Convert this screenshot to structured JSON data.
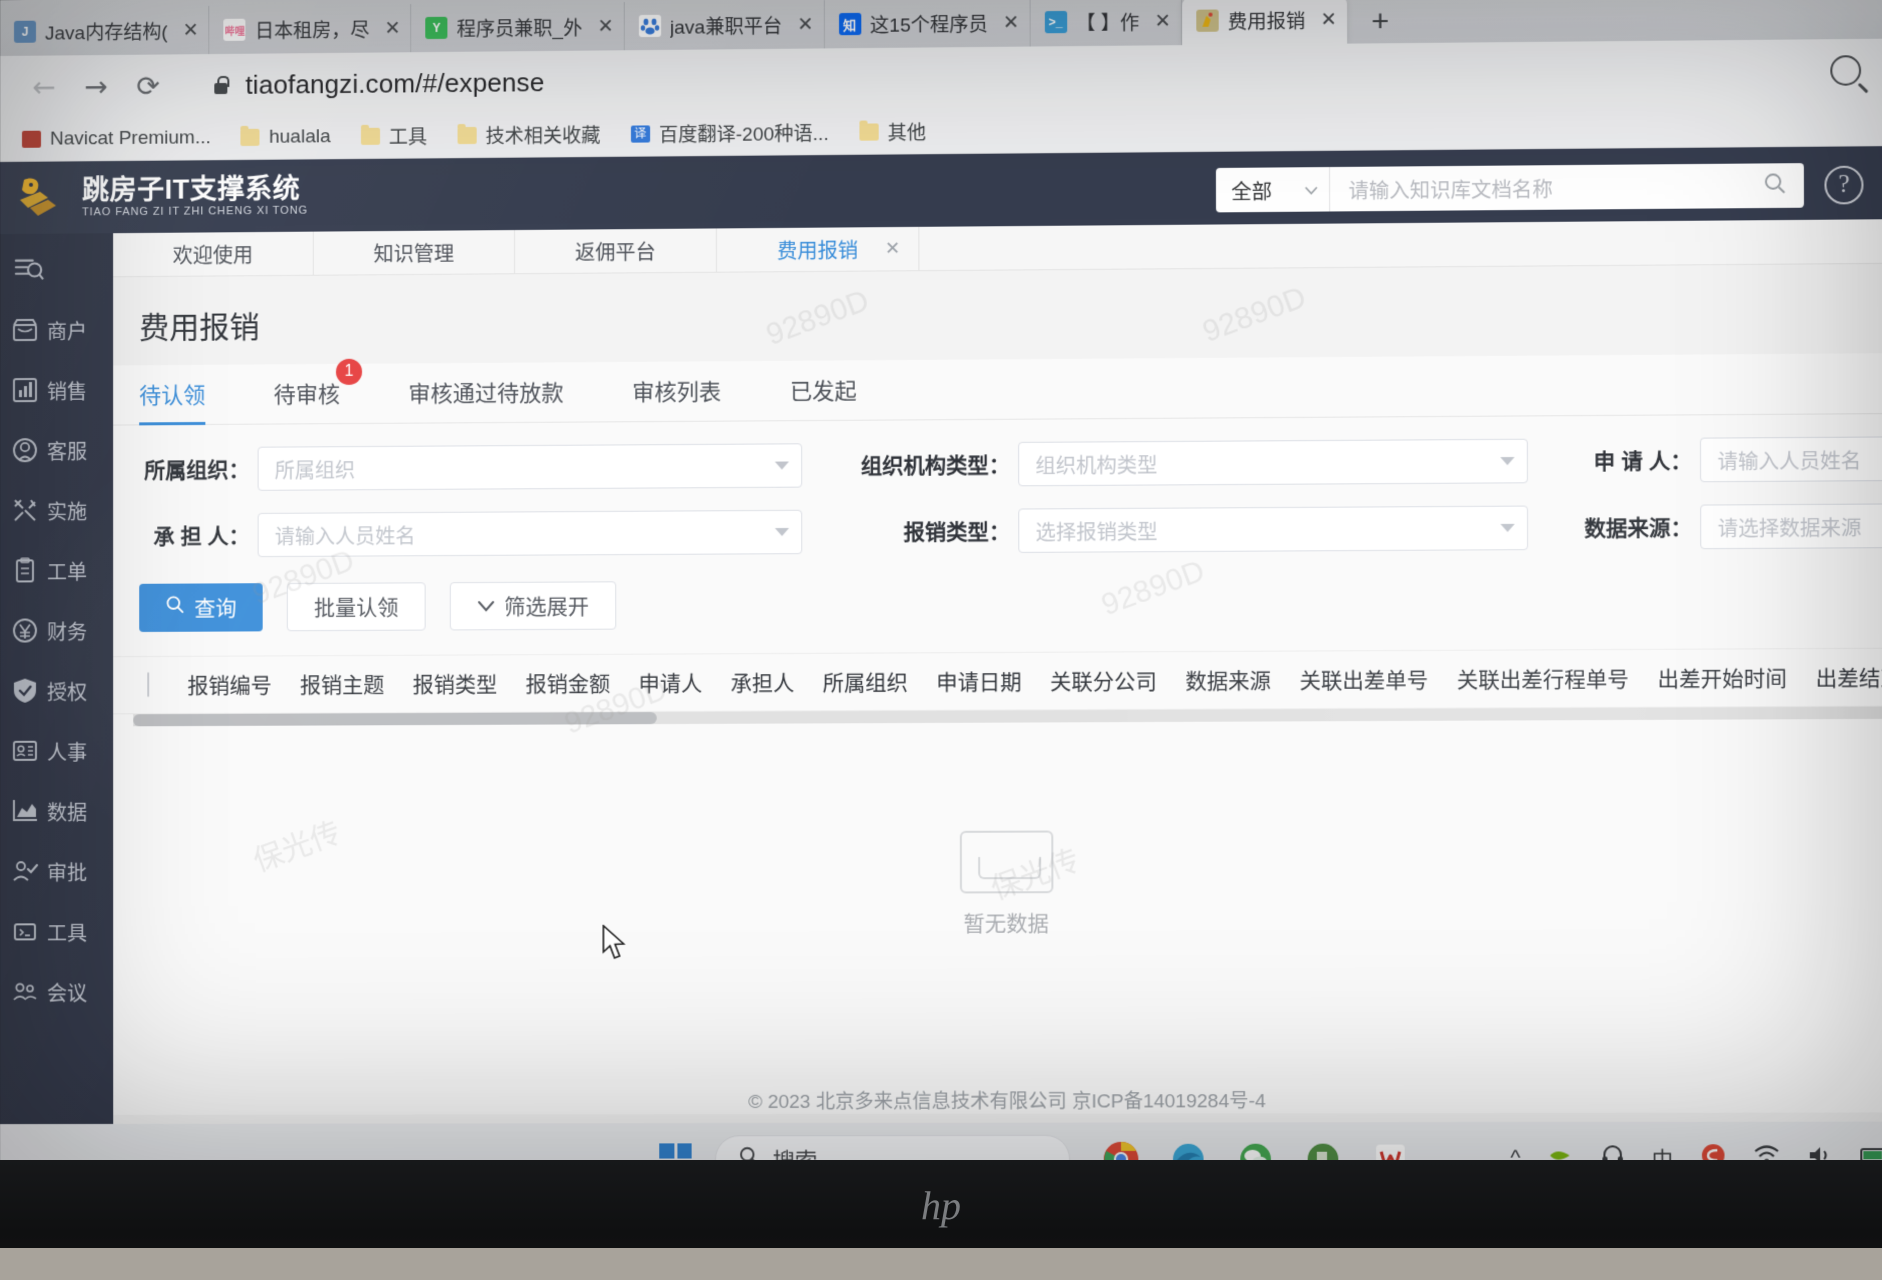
{
  "browser": {
    "tabs": [
      {
        "title": "Java内存结构(",
        "favicon": "java-icon",
        "color": "#5a8fc4",
        "active": false
      },
      {
        "title": "日本租房，尽",
        "favicon": "bilibili-icon",
        "color": "#fb7299",
        "active": false
      },
      {
        "title": "程序员兼职_外",
        "favicon": "yuanyuan-icon",
        "color": "#28b463",
        "active": false
      },
      {
        "title": "java兼职平台",
        "favicon": "baidu-icon",
        "color": "#ffffff",
        "active": false
      },
      {
        "title": "这15个程序员",
        "favicon": "zhihu-icon",
        "color": "#0066ff",
        "active": false
      },
      {
        "title": "【            】作",
        "favicon": "terminal-icon",
        "color": "#2d9cdb",
        "active": false
      },
      {
        "title": "费用报销",
        "favicon": "app-icon",
        "color": "#d8c88a",
        "active": true
      }
    ],
    "new_tab_label": "+",
    "close_label": "✕",
    "nav": {
      "back": "←",
      "forward": "→",
      "reload": "⟳"
    },
    "url": "tiaofangzi.com/#/expense",
    "bookmarks": [
      {
        "label": "Navicat Premium...",
        "icon": "navicat-icon"
      },
      {
        "label": "hualala",
        "icon": "folder-icon"
      },
      {
        "label": "工具",
        "icon": "folder-icon"
      },
      {
        "label": "技术相关收藏",
        "icon": "folder-icon"
      },
      {
        "label": "百度翻译-200种语...",
        "icon": "fanyi-icon"
      },
      {
        "label": "其他",
        "icon": "folder-icon"
      }
    ]
  },
  "app": {
    "logo": {
      "cn": "跳房子IT支撑系统",
      "en": "TIAO FANG ZI IT ZHI CHENG XI TONG"
    },
    "header_search": {
      "scope": "全部",
      "placeholder": "请输入知识库文档名称",
      "search_icon": "search-icon",
      "help_icon": "help-icon",
      "apps_icon": "grid-icon"
    },
    "sidebar": {
      "toggle_icon": "menu-search-icon",
      "items": [
        {
          "label": "商户",
          "icon": "shop-icon"
        },
        {
          "label": "销售",
          "icon": "chart-bar-icon"
        },
        {
          "label": "客服",
          "icon": "headset-icon"
        },
        {
          "label": "实施",
          "icon": "wrench-icon"
        },
        {
          "label": "工单",
          "icon": "clipboard-icon"
        },
        {
          "label": "财务",
          "icon": "yuan-icon"
        },
        {
          "label": "授权",
          "icon": "shield-check-icon"
        },
        {
          "label": "人事",
          "icon": "id-card-icon"
        },
        {
          "label": "数据",
          "icon": "area-chart-icon"
        },
        {
          "label": "审批",
          "icon": "approve-icon"
        },
        {
          "label": "工具",
          "icon": "tools-icon"
        },
        {
          "label": "会议",
          "icon": "meeting-icon"
        }
      ]
    },
    "doc_tabs": [
      {
        "label": "欢迎使用",
        "active": false,
        "closable": false
      },
      {
        "label": "知识管理",
        "active": false,
        "closable": false
      },
      {
        "label": "返佣平台",
        "active": false,
        "closable": false
      },
      {
        "label": "费用报销",
        "active": true,
        "closable": true,
        "close": "✕"
      }
    ],
    "page_title": "费用报销",
    "subtabs": [
      {
        "label": "待认领",
        "active": true,
        "badge": ""
      },
      {
        "label": "待审核",
        "active": false,
        "badge": "1"
      },
      {
        "label": "审核通过待放款",
        "active": false,
        "badge": ""
      },
      {
        "label": "审核列表",
        "active": false,
        "badge": ""
      },
      {
        "label": "已发起",
        "active": false,
        "badge": ""
      }
    ],
    "filters": {
      "row1": [
        {
          "label": "所属组织：",
          "placeholder": "所属组织",
          "type": "select",
          "value": ""
        },
        {
          "label": "组织机构类型：",
          "placeholder": "组织机构类型",
          "type": "select",
          "value": ""
        },
        {
          "label": "申 请 人：",
          "placeholder": "请输入人员姓名",
          "type": "input",
          "value": ""
        }
      ],
      "row2": [
        {
          "label": "承 担 人：",
          "placeholder": "请输入人员姓名",
          "type": "select",
          "value": ""
        },
        {
          "label": "报销类型：",
          "placeholder": "选择报销类型",
          "type": "select",
          "value": ""
        },
        {
          "label": "数据来源：",
          "placeholder": "请选择数据来源",
          "type": "select",
          "value": ""
        }
      ]
    },
    "buttons": {
      "search": "查询",
      "search_icon": "search-icon",
      "batch_claim": "批量认领",
      "expand_filter": "筛选展开",
      "expand_icon": "chevron-down-icon"
    },
    "table": {
      "select_all": "select-all-checkbox",
      "columns": [
        "报销编号",
        "报销主题",
        "报销类型",
        "报销金额",
        "申请人",
        "承担人",
        "所属组织",
        "申请日期",
        "关联分公司",
        "数据来源",
        "关联出差单号",
        "关联出差行程单号",
        "出差开始时间",
        "出差结束时间"
      ],
      "empty_text": "暂无数据",
      "rows": []
    },
    "footer": "© 2023 北京多来点信息技术有限公司  京ICP备14019284号-4",
    "watermarks": [
      "92890D",
      "92890D",
      "92890D",
      "保光传",
      "保光传"
    ]
  },
  "taskbar": {
    "start_icon": "windows-icon",
    "search_placeholder": "搜索",
    "search_icon": "search-icon",
    "apps": [
      {
        "name": "chrome-icon"
      },
      {
        "name": "edge-icon"
      },
      {
        "name": "wechat-icon"
      },
      {
        "name": "evernote-icon"
      },
      {
        "name": "wps-icon"
      }
    ],
    "tray": [
      {
        "name": "chevron-up-icon",
        "glyph": "^"
      },
      {
        "name": "nvidia-icon",
        "glyph": ""
      },
      {
        "name": "headphone-icon",
        "glyph": ""
      },
      {
        "name": "ime-icon",
        "glyph": "中"
      },
      {
        "name": "sogou-icon",
        "glyph": "S"
      },
      {
        "name": "wifi-icon",
        "glyph": ""
      },
      {
        "name": "volume-icon",
        "glyph": ""
      },
      {
        "name": "battery-icon",
        "glyph": ""
      }
    ]
  },
  "monitor": {
    "brand": "hp"
  },
  "colors": {
    "accent": "#2f8ce0",
    "header_bg": "#31394d",
    "sidebar_bg": "#2c3346",
    "badge": "#f23c3c",
    "page_bg": "#f3f3f3"
  }
}
